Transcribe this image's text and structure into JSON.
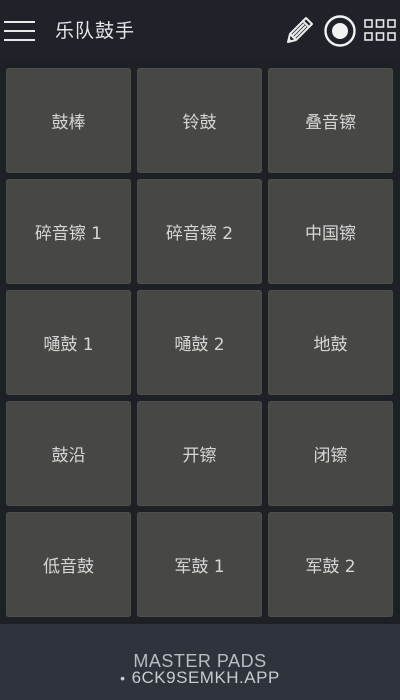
{
  "app": {
    "title": "乐队鼓手"
  },
  "toolbar": {
    "menu_icon": "hamburger-menu-icon",
    "edit_icon": "pencil-icon",
    "record_icon": "record-icon",
    "layout_icon": "grid-icon"
  },
  "pads": [
    {
      "label": "鼓棒"
    },
    {
      "label": "铃鼓"
    },
    {
      "label": "叠音镲"
    },
    {
      "label": "碎音镲 1"
    },
    {
      "label": "碎音镲 2"
    },
    {
      "label": "中国镲"
    },
    {
      "label": "嗵鼓 1"
    },
    {
      "label": "嗵鼓 2"
    },
    {
      "label": "地鼓"
    },
    {
      "label": "鼓沿"
    },
    {
      "label": "开镲"
    },
    {
      "label": "闭镲"
    },
    {
      "label": "低音鼓"
    },
    {
      "label": "军鼓 1"
    },
    {
      "label": "军鼓 2"
    }
  ],
  "footer": {
    "title": "MASTER PADS",
    "watermark": "6CK9SEMKH.APP"
  },
  "colors": {
    "background": "#1d2025",
    "pad": "#474845",
    "footer": "#2f333b",
    "text": "#d6d6d6"
  }
}
